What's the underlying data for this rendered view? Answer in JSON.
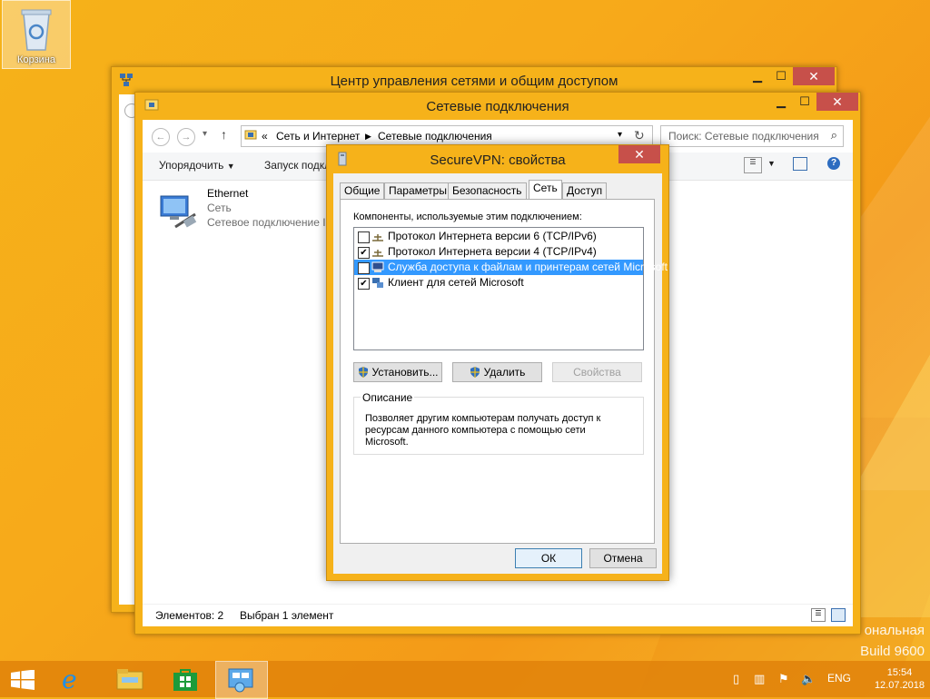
{
  "desktop": {
    "recycle_bin_label": "Корзина",
    "watermark_line1": "ональная",
    "watermark_line2": "Build 9600"
  },
  "back_window": {
    "title": "Центр управления сетями и общим доступом"
  },
  "connections_window": {
    "title": "Сетевые подключения",
    "breadcrumb_prefix": "«",
    "breadcrumb_1": "Сеть и Интернет",
    "breadcrumb_2": "Сетевые подключения",
    "search_placeholder": "Поиск: Сетевые подключения",
    "toolbar_organize": "Упорядочить",
    "toolbar_launch": "Запуск подкл",
    "item_name": "Ethernet",
    "item_network": "Сеть",
    "item_desc": "Сетевое подключение In",
    "status_count": "Элементов: 2",
    "status_selected": "Выбран 1 элемент"
  },
  "dialog": {
    "title": "SecureVPN: свойства",
    "tabs": [
      "Общие",
      "Параметры",
      "Безопасность",
      "Сеть",
      "Доступ"
    ],
    "components_label": "Компоненты, используемые этим подключением:",
    "components": [
      {
        "label": "Протокол Интернета версии 6 (TCP/IPv6)",
        "checked": false
      },
      {
        "label": "Протокол Интернета версии 4 (TCP/IPv4)",
        "checked": true
      },
      {
        "label": "Служба доступа к файлам и принтерам сетей Microsoft",
        "checked": false
      },
      {
        "label": "Клиент для сетей Microsoft",
        "checked": true
      }
    ],
    "install_button": "Установить...",
    "remove_button": "Удалить",
    "properties_button": "Свойства",
    "description_legend": "Описание",
    "description_text": "Позволяет другим компьютерам получать доступ к ресурсам данного компьютера с помощью сети Microsoft.",
    "ok_button": "ОК",
    "cancel_button": "Отмена"
  },
  "taskbar": {
    "language": "ENG",
    "time": "15:54",
    "date": "12.07.2018"
  },
  "colors": {
    "accent_window": "#f6b21a",
    "selection": "#3399ff",
    "close_button": "#c7504a"
  }
}
